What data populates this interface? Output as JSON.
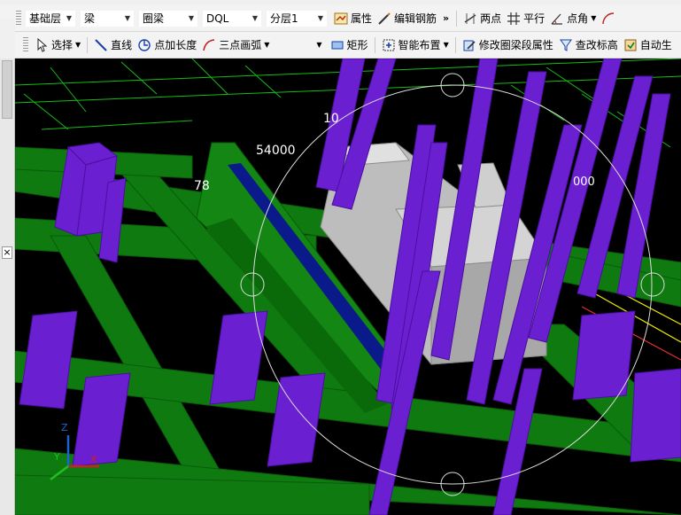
{
  "toolbar1": {
    "combos": [
      {
        "value": "基础层",
        "width": 58
      },
      {
        "value": "梁",
        "width": 62
      },
      {
        "value": "圈梁",
        "width": 68
      },
      {
        "value": "DQL",
        "width": 68
      },
      {
        "value": "分层1",
        "width": 70
      }
    ],
    "buttons": {
      "property": "属性",
      "edit_rebar": "编辑钢筋",
      "two_points": "两点",
      "parallel": "平行",
      "point_angle": "点角"
    }
  },
  "toolbar2": {
    "select": "选择",
    "line": "直线",
    "point_length": "点加长度",
    "three_point_arc": "三点画弧",
    "rect": "矩形",
    "smart_layout": "智能布置",
    "modify_props": "修改圈梁段属性",
    "check_elevation": "查改标高",
    "auto_gen": "自动生"
  },
  "viewport": {
    "labels": {
      "dim_54000": "54000",
      "dim_78": "78",
      "dim_10": "10",
      "dim_right": "000"
    },
    "axis": {
      "x": "X",
      "y": "Y",
      "z": "Z"
    },
    "colors": {
      "background": "#000000",
      "beam": "#0f7a0f",
      "column": "#6a1fd0",
      "box": "#bdbdbd",
      "grid": "#18d018"
    }
  }
}
